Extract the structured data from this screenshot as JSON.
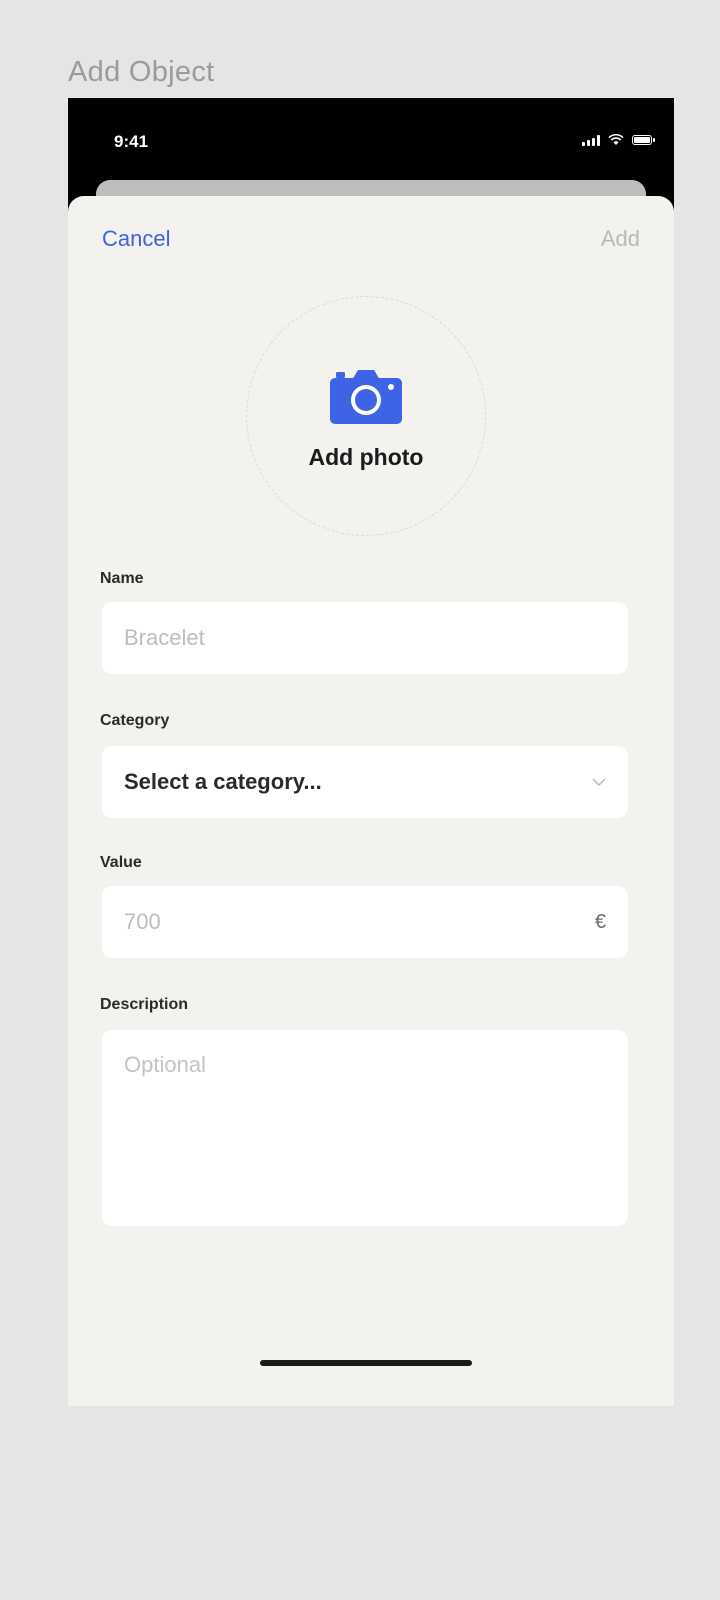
{
  "frame": {
    "label": "Add Object"
  },
  "status_bar": {
    "time": "9:41"
  },
  "nav": {
    "cancel_label": "Cancel",
    "add_label": "Add"
  },
  "photo": {
    "label": "Add photo",
    "icon": "camera-icon"
  },
  "fields": {
    "name": {
      "label": "Name",
      "placeholder": "Bracelet"
    },
    "category": {
      "label": "Category",
      "value": "Select a category..."
    },
    "value": {
      "label": "Value",
      "placeholder": "700",
      "currency": "€"
    },
    "description": {
      "label": "Description",
      "placeholder": "Optional"
    }
  },
  "colors": {
    "accent": "#3e63e6",
    "sheet_bg": "#f3f2ef",
    "page_bg": "#e5e5e5"
  }
}
